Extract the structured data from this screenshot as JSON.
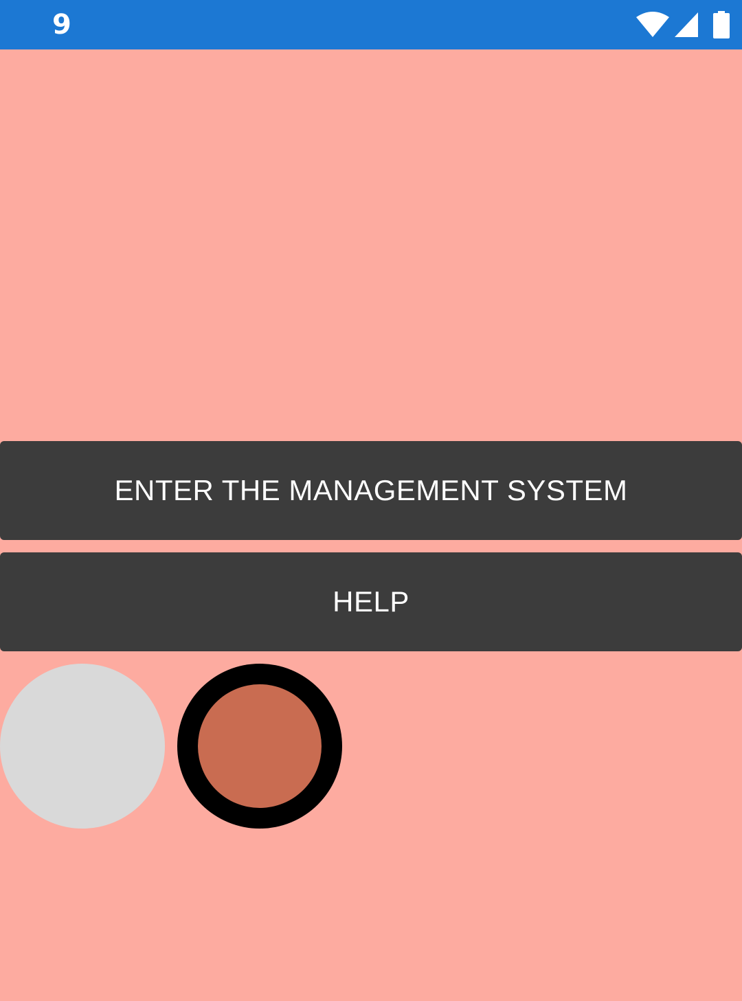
{
  "status_bar": {
    "time": "9",
    "icons": [
      "wifi-icon",
      "cell-signal-icon",
      "battery-icon"
    ],
    "color": "#1C78D3"
  },
  "main": {
    "background": "#FDABA0",
    "enter_button_label": "ENTER THE MANAGEMENT SYSTEM",
    "help_button_label": "HELP",
    "button_color": "#3C3C3C"
  },
  "circles": [
    {
      "name": "light-gray-circle",
      "color": "#D9D9D9"
    },
    {
      "name": "ringed-circle",
      "ring_color": "#000000",
      "fill_color": "#C96C51"
    }
  ]
}
